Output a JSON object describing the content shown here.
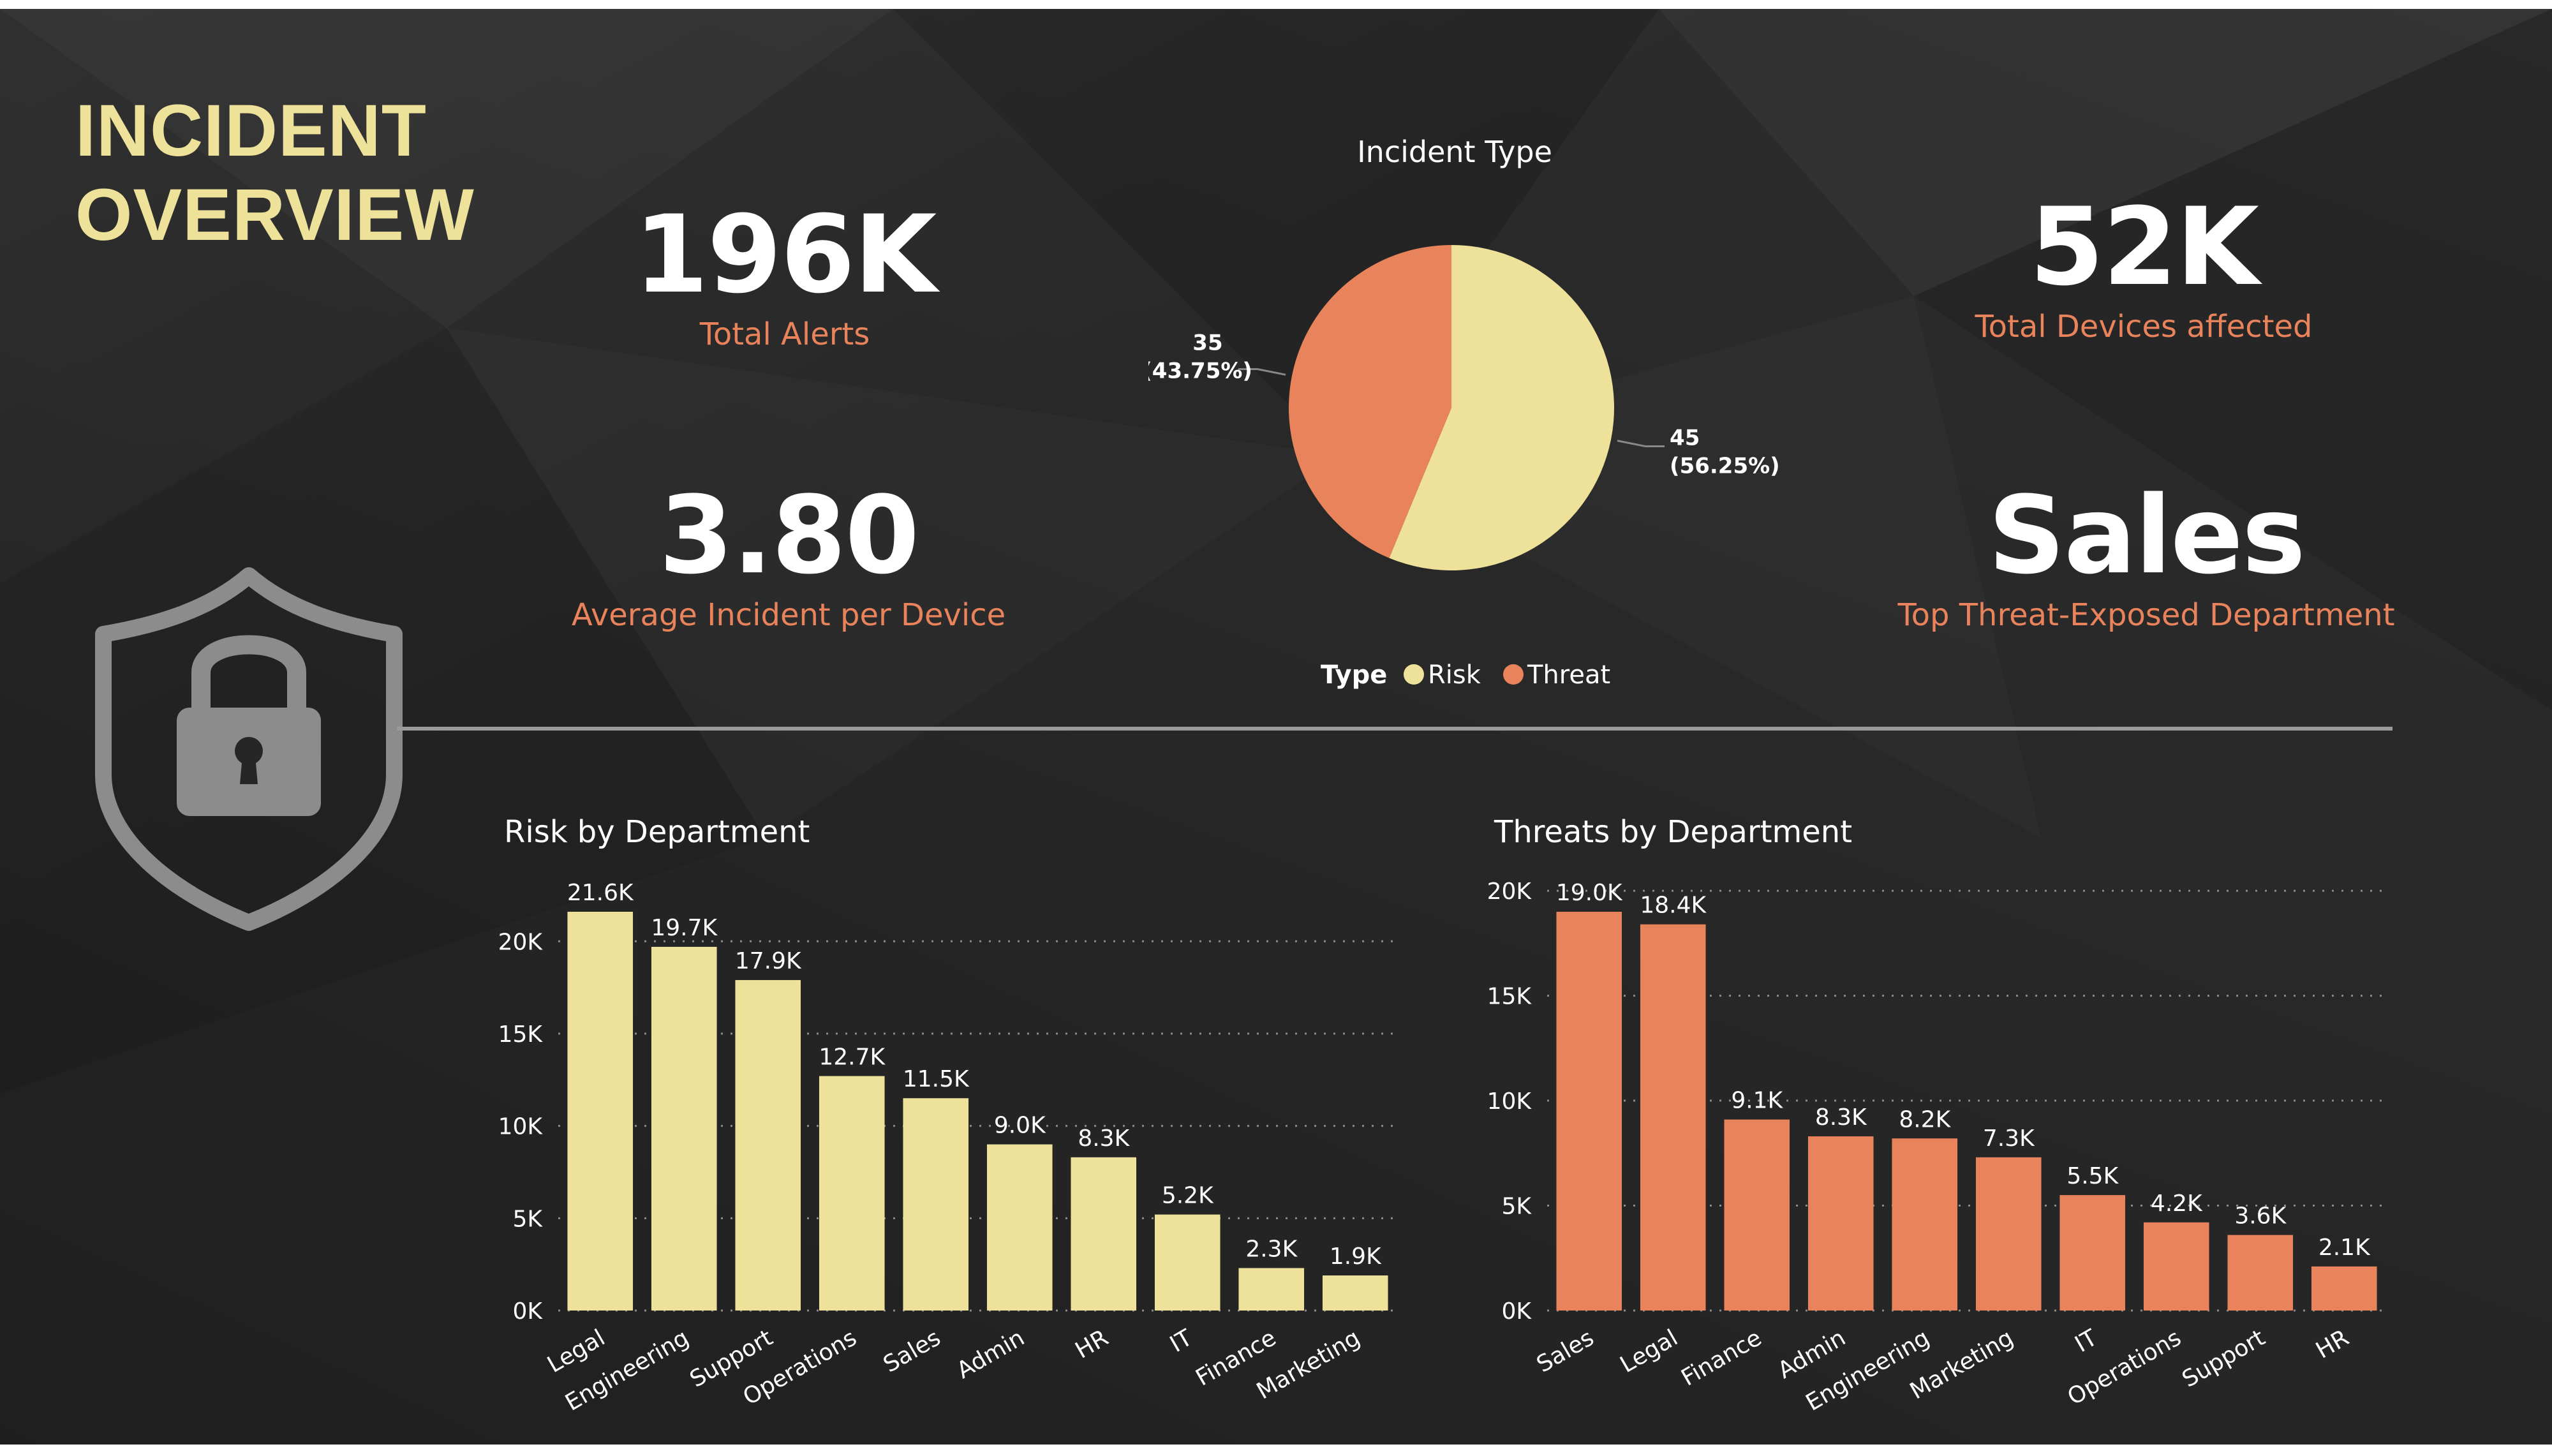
{
  "header": {
    "title_line1": "INCIDENT",
    "title_line2": "OVERVIEW"
  },
  "kpis": {
    "total_alerts": {
      "value": "196K",
      "label": "Total Alerts"
    },
    "avg_incident": {
      "value": "3.80",
      "label": "Average Incident per Device"
    },
    "devices_affected": {
      "value": "52K",
      "label": "Total Devices affected"
    },
    "top_department": {
      "value": "Sales",
      "label": "Top Threat-Exposed Department"
    }
  },
  "icons": {
    "shield": "shield-lock-icon"
  },
  "colors": {
    "risk": "#eee29b",
    "threat": "#e8835c",
    "background": "#262626"
  },
  "chart_data": [
    {
      "type": "pie",
      "title": "Incident Type",
      "legend_title": "Type",
      "legend_position": "bottom",
      "slices": [
        {
          "name": "Risk",
          "value": 45,
          "label_value": "45",
          "label_pct": "(56.25%)",
          "color": "#eee29b"
        },
        {
          "name": "Threat",
          "value": 35,
          "label_value": "35",
          "label_pct": "(43.75%)",
          "color": "#e8835c"
        }
      ]
    },
    {
      "type": "bar",
      "title": "Risk by Department",
      "color": "#eee29b",
      "categories": [
        "Legal",
        "Engineering",
        "Support",
        "Operations",
        "Sales",
        "Admin",
        "HR",
        "IT",
        "Finance",
        "Marketing"
      ],
      "values": [
        21600,
        19700,
        17900,
        12700,
        11500,
        9000,
        8300,
        5200,
        2300,
        1900
      ],
      "labels": [
        "21.6K",
        "19.7K",
        "17.9K",
        "12.7K",
        "11.5K",
        "9.0K",
        "8.3K",
        "5.2K",
        "2.3K",
        "1.9K"
      ],
      "yticks": [
        0,
        5000,
        10000,
        15000,
        20000
      ],
      "ytick_labels": [
        "0K",
        "5K",
        "10K",
        "15K",
        "20K"
      ],
      "ylim": [
        0,
        21600
      ],
      "grid": true
    },
    {
      "type": "bar",
      "title": "Threats by Department",
      "color": "#e8835c",
      "categories": [
        "Sales",
        "Legal",
        "Finance",
        "Admin",
        "Engineering",
        "Marketing",
        "IT",
        "Operations",
        "Support",
        "HR"
      ],
      "values": [
        19000,
        18400,
        9100,
        8300,
        8200,
        7300,
        5500,
        4200,
        3600,
        2100
      ],
      "labels": [
        "19.0K",
        "18.4K",
        "9.1K",
        "8.3K",
        "8.2K",
        "7.3K",
        "5.5K",
        "4.2K",
        "3.6K",
        "2.1K"
      ],
      "yticks": [
        0,
        5000,
        10000,
        15000,
        20000
      ],
      "ytick_labels": [
        "0K",
        "5K",
        "10K",
        "15K",
        "20K"
      ],
      "ylim": [
        0,
        19000
      ],
      "grid": true
    }
  ]
}
